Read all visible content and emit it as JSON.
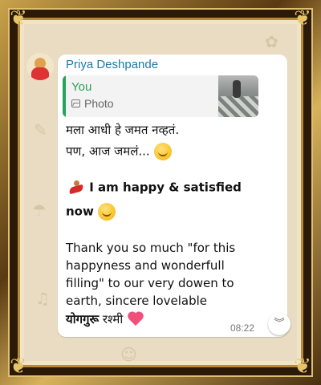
{
  "message": {
    "sender": "Priya Deshpande",
    "quote": {
      "author": "You",
      "type_label": "Photo",
      "type_icon": "photo-icon"
    },
    "lines": [
      "मला आधी हे जमत नव्हतं.",
      "पण, आज जमलं..."
    ],
    "highlight_line1": "I am happy & satisfied",
    "highlight_line2": "now",
    "thanks_lines": [
      "Thank you so much \"for this",
      "happyness and wonderfull",
      "filling\" to our very dowen to",
      "earth, sincere lovelable"
    ],
    "signoff_bold": "योगगुरू",
    "signoff_name": "रश्मी",
    "time": "08:22"
  },
  "colors": {
    "sender": "#1f7aa8",
    "quote_accent": "#25a35a",
    "bubble": "#ffffff",
    "frame_gold": "#c9a24a"
  }
}
